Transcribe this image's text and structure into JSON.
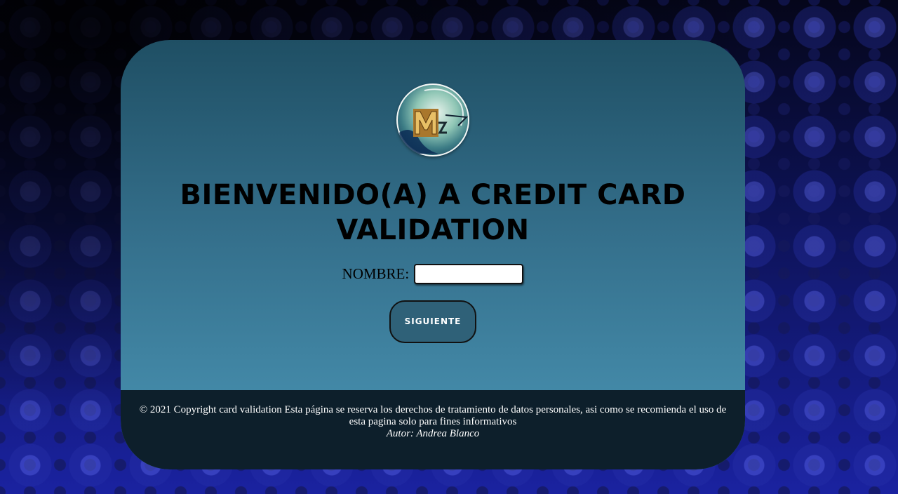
{
  "card": {
    "title_line1": "BIENVENIDO(A) A CREDIT CARD",
    "title_line2": "VALIDATION",
    "logo_icon": "globe-logo-icon"
  },
  "form": {
    "name_label": "NOMBRE:",
    "name_value": "",
    "name_placeholder": "",
    "submit_label": "SIGUIENTE"
  },
  "footer": {
    "copyright": "© 2021 Copyright card validation Esta página se reserva los derechos de tratamiento de datos personales, asi como se recomienda el uso de esta pagina solo para fines informativos",
    "author": "Autor: Andrea Blanco"
  },
  "colors": {
    "card_top": "#1f4f64",
    "card_bottom": "#4a95b5",
    "button": "#2f6178",
    "footer": "#0d1f2b"
  }
}
